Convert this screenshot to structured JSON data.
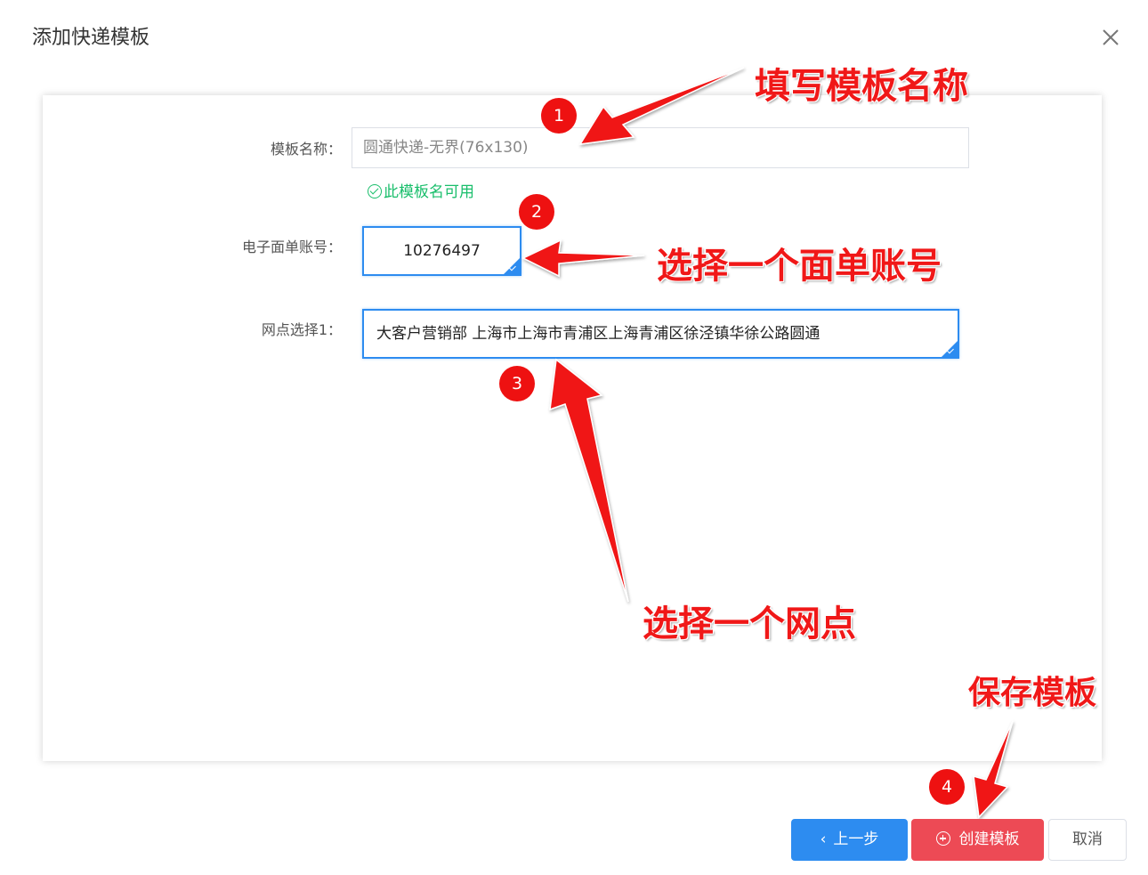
{
  "dialog": {
    "title": "添加快递模板"
  },
  "form": {
    "name_label": "模板名称：",
    "name_value": "圆通快递-无界(76x130)",
    "name_hint": "此模板名可用",
    "account_label": "电子面单账号：",
    "account_value": "10276497",
    "site_label": "网点选择1：",
    "site_value": "大客户营销部 上海市上海市青浦区上海青浦区徐泾镇华徐公路圆通"
  },
  "annotations": {
    "step1": "1",
    "step2": "2",
    "step3": "3",
    "step4": "4",
    "fill_name": "填写模板名称",
    "choose_account": "选择一个面单账号",
    "choose_site": "选择一个网点",
    "save_template": "保存模板"
  },
  "footer": {
    "prev_label": "上一步",
    "create_label": "创建模板",
    "cancel_label": "取消"
  },
  "colors": {
    "primary": "#2d8cf0",
    "danger": "#ed4a55",
    "success": "#19be6b",
    "annotation_red": "#f01818"
  }
}
